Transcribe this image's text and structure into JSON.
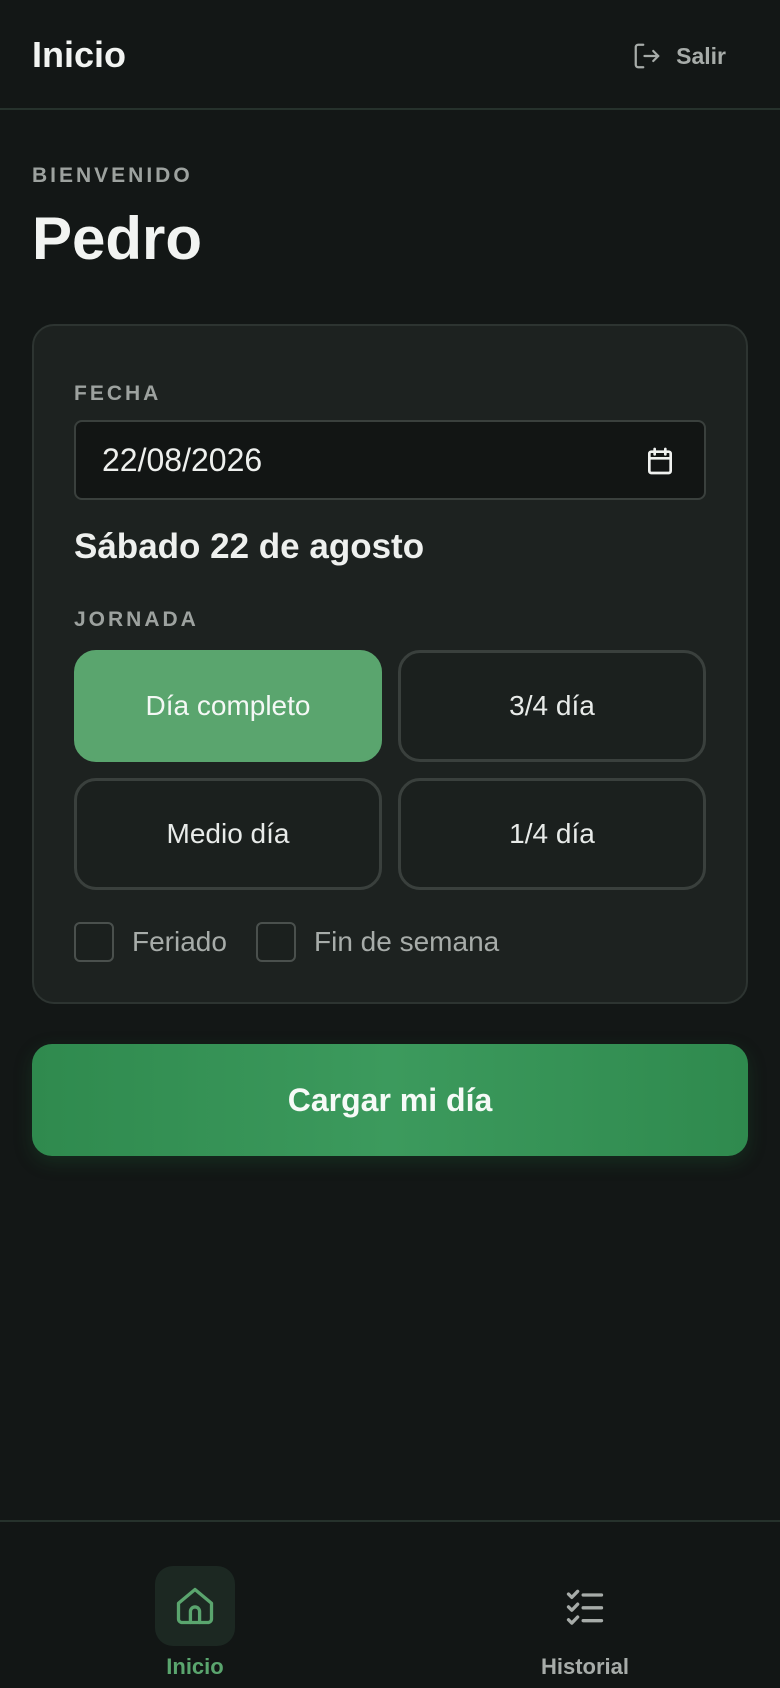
{
  "header": {
    "title": "Inicio",
    "logout_label": "Salir"
  },
  "welcome": {
    "label": "BIENVENIDO",
    "name": "Pedro"
  },
  "form": {
    "date_label": "FECHA",
    "date_value": "22/08/2026",
    "date_long": "Sábado 22 de agosto",
    "shift_label": "JORNADA",
    "shifts": [
      {
        "label": "Día completo",
        "selected": true
      },
      {
        "label": "3/4 día",
        "selected": false
      },
      {
        "label": "Medio día",
        "selected": false
      },
      {
        "label": "1/4 día",
        "selected": false
      }
    ],
    "holiday_label": "Feriado",
    "weekend_label": "Fin de semana",
    "submit_label": "Cargar mi día"
  },
  "nav": {
    "items": [
      {
        "label": "Inicio",
        "icon": "home-icon",
        "active": true
      },
      {
        "label": "Historial",
        "icon": "checklist-icon",
        "active": false
      }
    ]
  },
  "colors": {
    "background": "#131716",
    "card": "#1d2220",
    "accent": "#5aa56e",
    "primary_button": "#3c9a5d"
  }
}
